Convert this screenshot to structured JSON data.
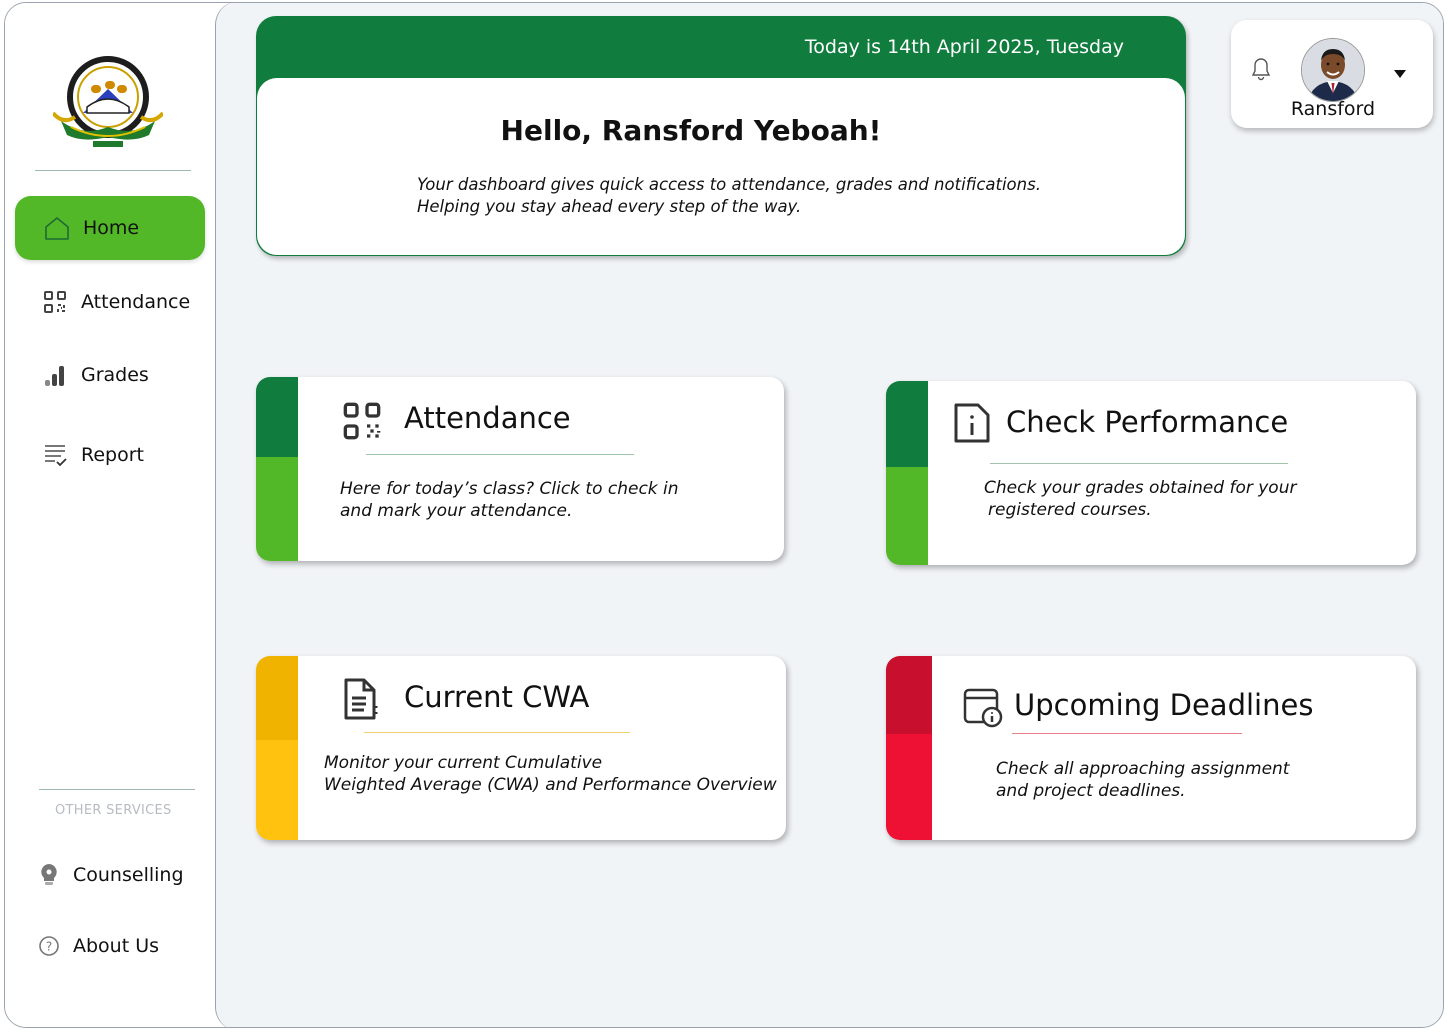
{
  "sidebar": {
    "nav": [
      {
        "label": "Home",
        "icon": "home-icon",
        "active": true
      },
      {
        "label": "Attendance",
        "icon": "qr-code-icon"
      },
      {
        "label": "Grades",
        "icon": "bar-chart-icon"
      },
      {
        "label": "Report",
        "icon": "report-icon"
      }
    ],
    "other_services_label": "OTHER SERVICES",
    "other": [
      {
        "label": "Counselling",
        "icon": "lightbulb-icon"
      },
      {
        "label": "About Us",
        "icon": "help-circle-icon"
      }
    ]
  },
  "header": {
    "date_text": "Today is 14th April 2025, Tuesday",
    "greeting": "Hello, Ransford Yeboah!",
    "subtitle_line1": "Your dashboard gives quick access to attendance, grades and notifications.",
    "subtitle_line2": "Helping you stay ahead every step of the way."
  },
  "user": {
    "name": "Ransford"
  },
  "tiles": [
    {
      "title": "Attendance",
      "desc1": "Here for today’s class? Click to check in",
      "desc2": "and mark your attendance.",
      "icon": "qr-code-icon",
      "color_top": "#107c3d",
      "color_bottom": "#53b827"
    },
    {
      "title": "Check Performance",
      "desc1": "Check your grades obtained for your",
      "desc2": "registered courses.",
      "icon": "info-document-icon",
      "color_top": "#107c3d",
      "color_bottom": "#53b827"
    },
    {
      "title": "Current CWA",
      "desc1": "Monitor your current Cumulative",
      "desc2": "Weighted Average (CWA) and Performance Overview",
      "icon": "document-list-icon",
      "color_top": "#f0b400",
      "color_bottom": "#ffc20e"
    },
    {
      "title": "Upcoming Deadlines",
      "desc1": "Check all approaching assignment",
      "desc2": "and project deadlines.",
      "icon": "calendar-info-icon",
      "color_top": "#c8102e",
      "color_bottom": "#ee1133"
    }
  ],
  "colors": {
    "primary_green": "#107c3d",
    "accent_green": "#53b827",
    "yellow": "#ffc20e",
    "red": "#ee1133",
    "background": "#f1f4f7"
  }
}
